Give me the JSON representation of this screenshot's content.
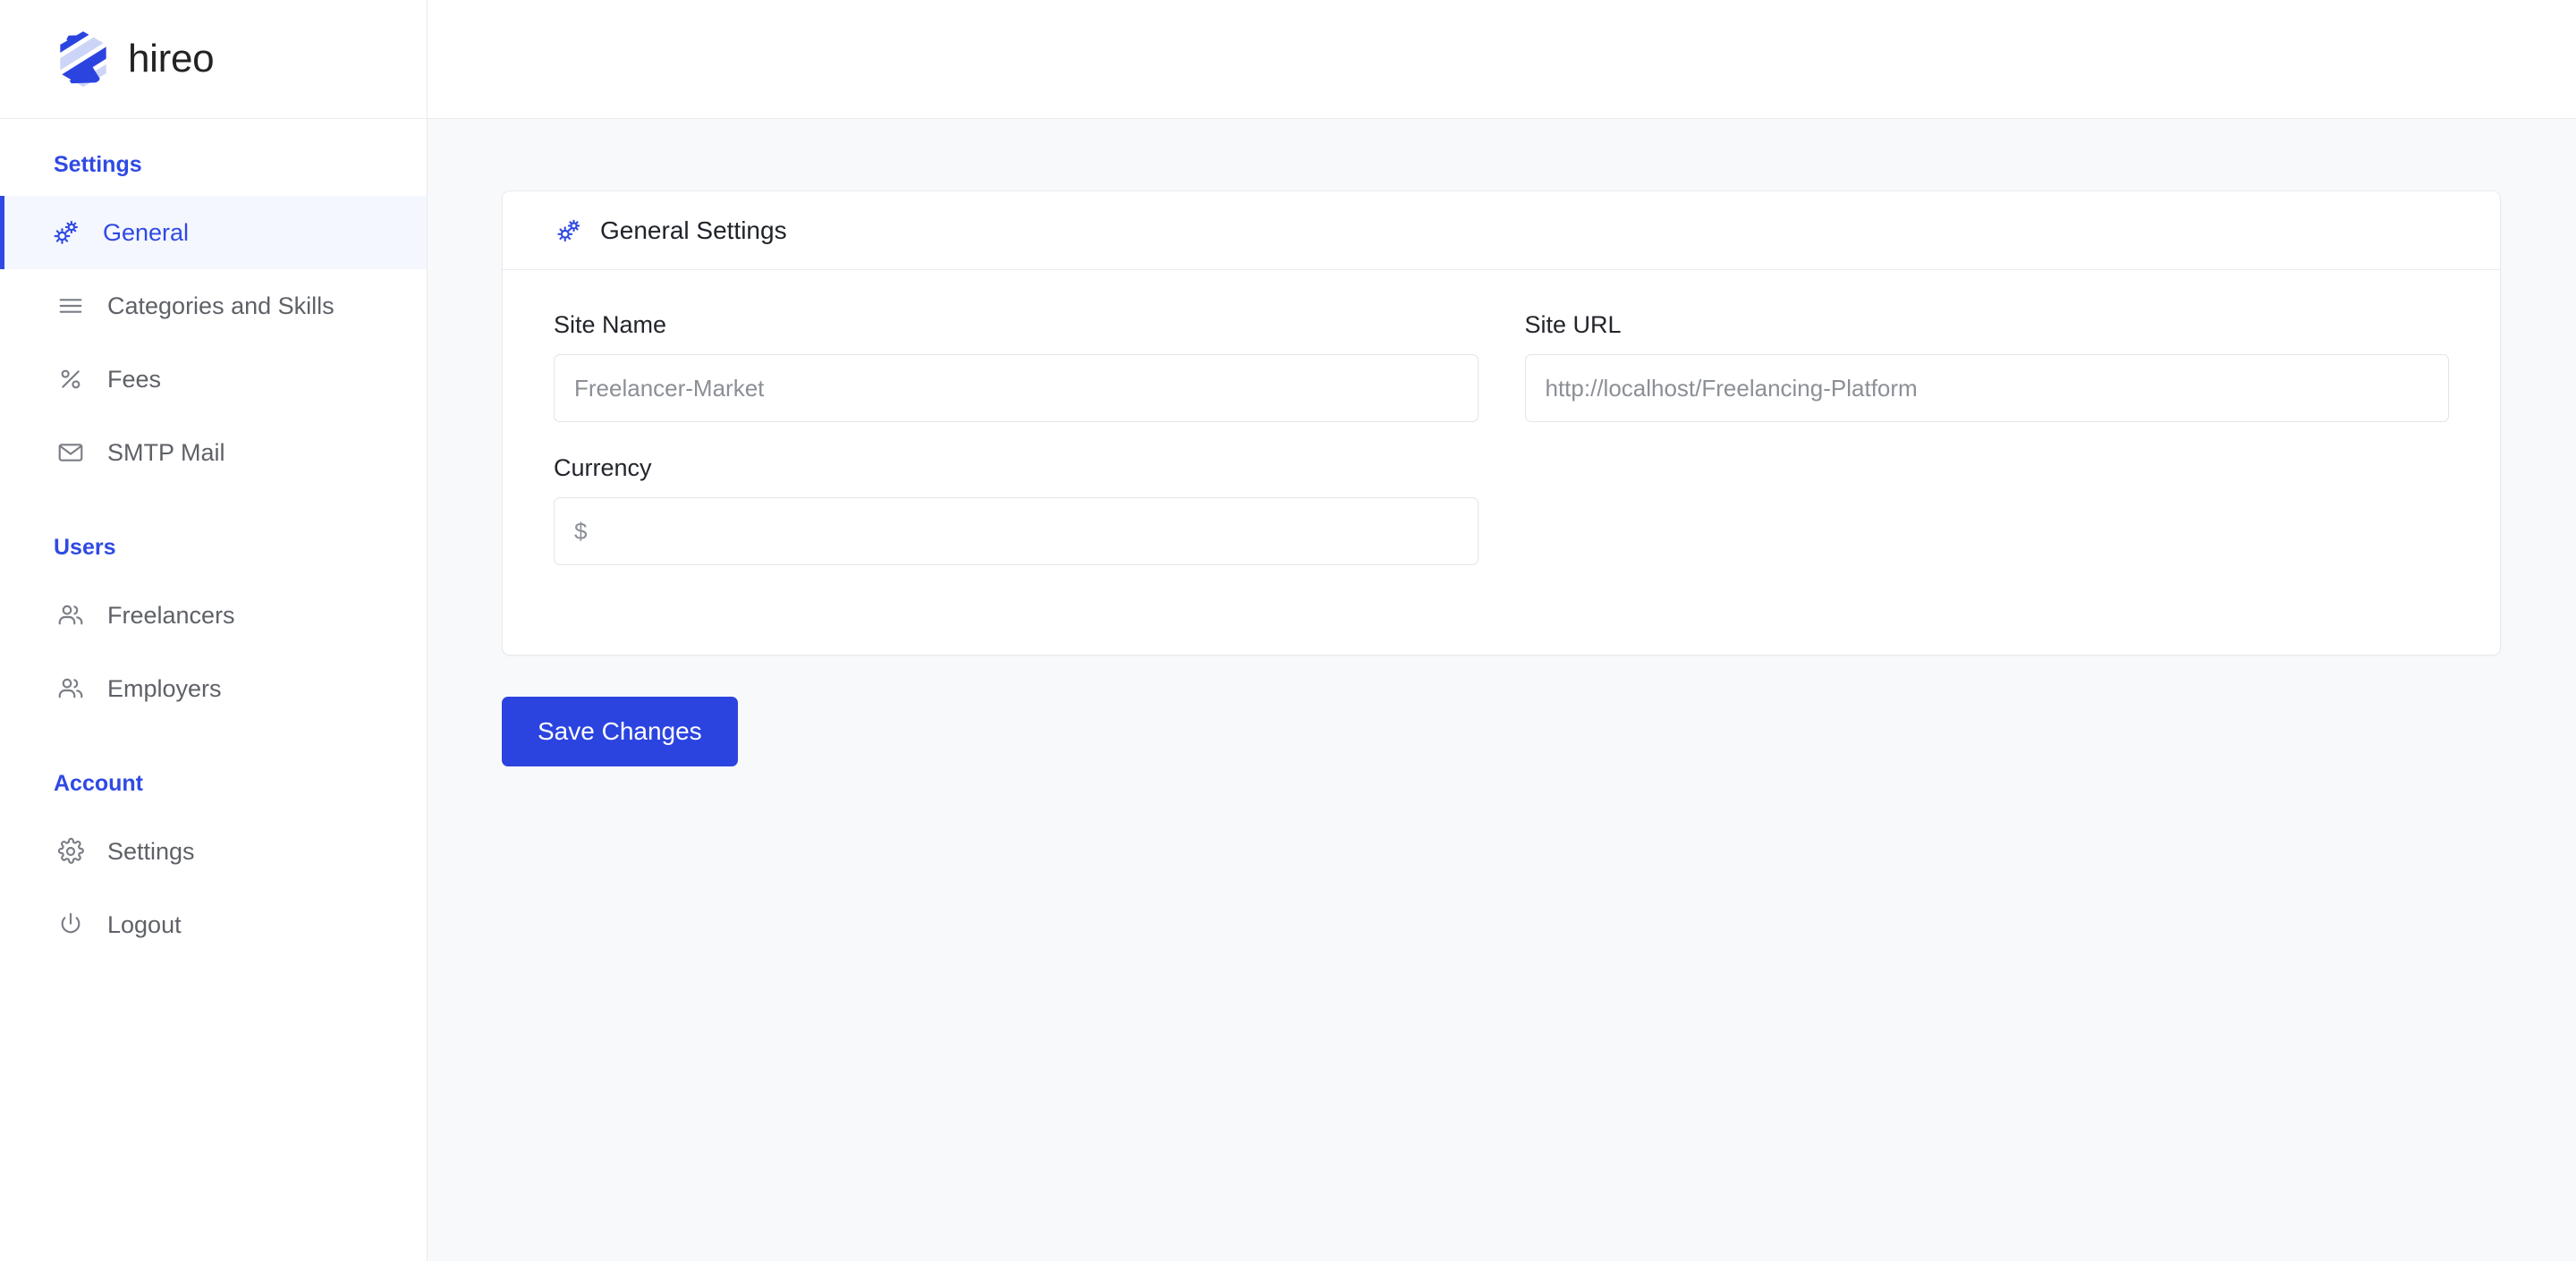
{
  "brand": {
    "name": "hireo",
    "logo_icon": "hireo-hexagon-logo",
    "accent_color": "#2b44e0"
  },
  "sidebar": {
    "sections": [
      {
        "title": "Settings",
        "items": [
          {
            "label": "General",
            "icon": "gears-icon",
            "active": true
          },
          {
            "label": "Categories and Skills",
            "icon": "list-lines-icon",
            "active": false
          },
          {
            "label": "Fees",
            "icon": "percent-icon",
            "active": false
          },
          {
            "label": "SMTP Mail",
            "icon": "envelope-icon",
            "active": false
          }
        ]
      },
      {
        "title": "Users",
        "items": [
          {
            "label": "Freelancers",
            "icon": "users-icon",
            "active": false
          },
          {
            "label": "Employers",
            "icon": "users-icon",
            "active": false
          }
        ]
      },
      {
        "title": "Account",
        "items": [
          {
            "label": "Settings",
            "icon": "gear-icon",
            "active": false
          },
          {
            "label": "Logout",
            "icon": "power-icon",
            "active": false
          }
        ]
      }
    ]
  },
  "card": {
    "icon": "gears-icon",
    "title": "General Settings",
    "fields": [
      {
        "label": "Site Name",
        "value": "Freelancer-Market",
        "placeholder": "Freelancer-Market",
        "name": "site-name"
      },
      {
        "label": "Site URL",
        "value": "http://localhost/Freelancing-Platform",
        "placeholder": "http://localhost/Freelancing-Platform",
        "name": "site-url"
      },
      {
        "label": "Currency",
        "value": "$",
        "placeholder": "$",
        "name": "currency"
      }
    ]
  },
  "actions": {
    "save_label": "Save Changes"
  }
}
